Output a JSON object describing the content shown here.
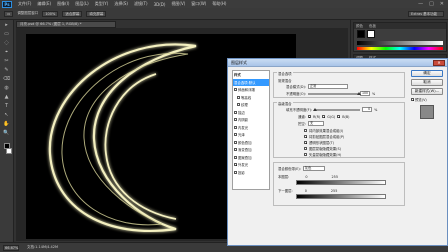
{
  "app": {
    "logo": "Ps",
    "menu": [
      "文件(F)",
      "编辑(E)",
      "图像(I)",
      "图层(L)",
      "类型(Y)",
      "选择(S)",
      "滤镜(T)",
      "3D(D)",
      "视图(V)",
      "窗口(W)",
      "帮助(H)"
    ],
    "window_buttons": [
      "—",
      "□",
      "✕"
    ]
  },
  "options_bar": {
    "tool_select": "▭",
    "mode_label": "调整图层窗口",
    "zoom_value": "100%",
    "fit_button": "适合屏幕",
    "fill_button": "填充屏幕",
    "workspace": "Extras 基本功能"
  },
  "document": {
    "tab_title": "月亮.psd @ 66.7% (图层 1, RGB/8) *",
    "zoom": "66.67%",
    "status": "文档:1.14M/4.42M"
  },
  "tools": [
    "▸",
    "▭",
    "◌",
    "⌖",
    "✂",
    "✎",
    "⌫",
    "◍",
    "▲",
    "T",
    "↖",
    "✋",
    "🔍"
  ],
  "panels": {
    "color_tabs": [
      "颜色",
      "色板"
    ],
    "adjust_tabs": [
      "调整",
      "样式"
    ],
    "layer_tabs": [
      "图层",
      "通道",
      "路径"
    ]
  },
  "dialog": {
    "title": "图层样式",
    "close": "✕",
    "style_list": [
      {
        "label": "样式",
        "checked": null,
        "type": "header"
      },
      {
        "label": "混合选项:默认",
        "checked": null,
        "type": "selected"
      },
      {
        "label": "斜面和浮雕",
        "checked": false,
        "type": "item"
      },
      {
        "label": "等高线",
        "checked": false,
        "type": "sub"
      },
      {
        "label": "纹理",
        "checked": false,
        "type": "sub"
      },
      {
        "label": "描边",
        "checked": false,
        "type": "item"
      },
      {
        "label": "内阴影",
        "checked": false,
        "type": "item"
      },
      {
        "label": "内发光",
        "checked": false,
        "type": "item"
      },
      {
        "label": "光泽",
        "checked": false,
        "type": "item"
      },
      {
        "label": "颜色叠加",
        "checked": false,
        "type": "item"
      },
      {
        "label": "渐变叠加",
        "checked": false,
        "type": "item"
      },
      {
        "label": "图案叠加",
        "checked": false,
        "type": "item"
      },
      {
        "label": "外发光",
        "checked": true,
        "type": "item"
      },
      {
        "label": "投影",
        "checked": false,
        "type": "item"
      }
    ],
    "general": {
      "section_title": "混合选项",
      "group_title": "常规混合",
      "blend_mode_label": "混合模式(D):",
      "blend_mode_value": "正常",
      "opacity_label": "不透明度(O):",
      "opacity_value": "100",
      "unit": "%"
    },
    "advanced": {
      "group_title": "高级混合",
      "fill_opacity_label": "填充不透明度(F):",
      "fill_opacity_value": "0",
      "unit": "%",
      "channels_label": "通道:",
      "channels": [
        {
          "label": "R(R)",
          "checked": true
        },
        {
          "label": "G(G)",
          "checked": true
        },
        {
          "label": "B(B)",
          "checked": true
        }
      ],
      "knockout_label": "挖空:",
      "knockout_value": "无",
      "options": [
        {
          "label": "将内部效果混合成组(I)",
          "checked": false
        },
        {
          "label": "将剪贴图层混合成组(P)",
          "checked": true
        },
        {
          "label": "透明形状图层(T)",
          "checked": true
        },
        {
          "label": "图层蒙版隐藏效果(S)",
          "checked": false
        },
        {
          "label": "矢量蒙版隐藏效果(H)",
          "checked": false
        }
      ]
    },
    "blend_if": {
      "label": "混合颜色带(E):",
      "value": "灰色",
      "this_layer_label": "本图层:",
      "this_layer_min": "0",
      "this_layer_max": "255",
      "underlying_label": "下一图层:",
      "underlying_min": "0",
      "underlying_max": "255"
    },
    "buttons": {
      "ok": "确定",
      "cancel": "取消",
      "new_style": "新建样式(W)...",
      "preview_label": "预览(V)",
      "preview_checked": true
    }
  }
}
